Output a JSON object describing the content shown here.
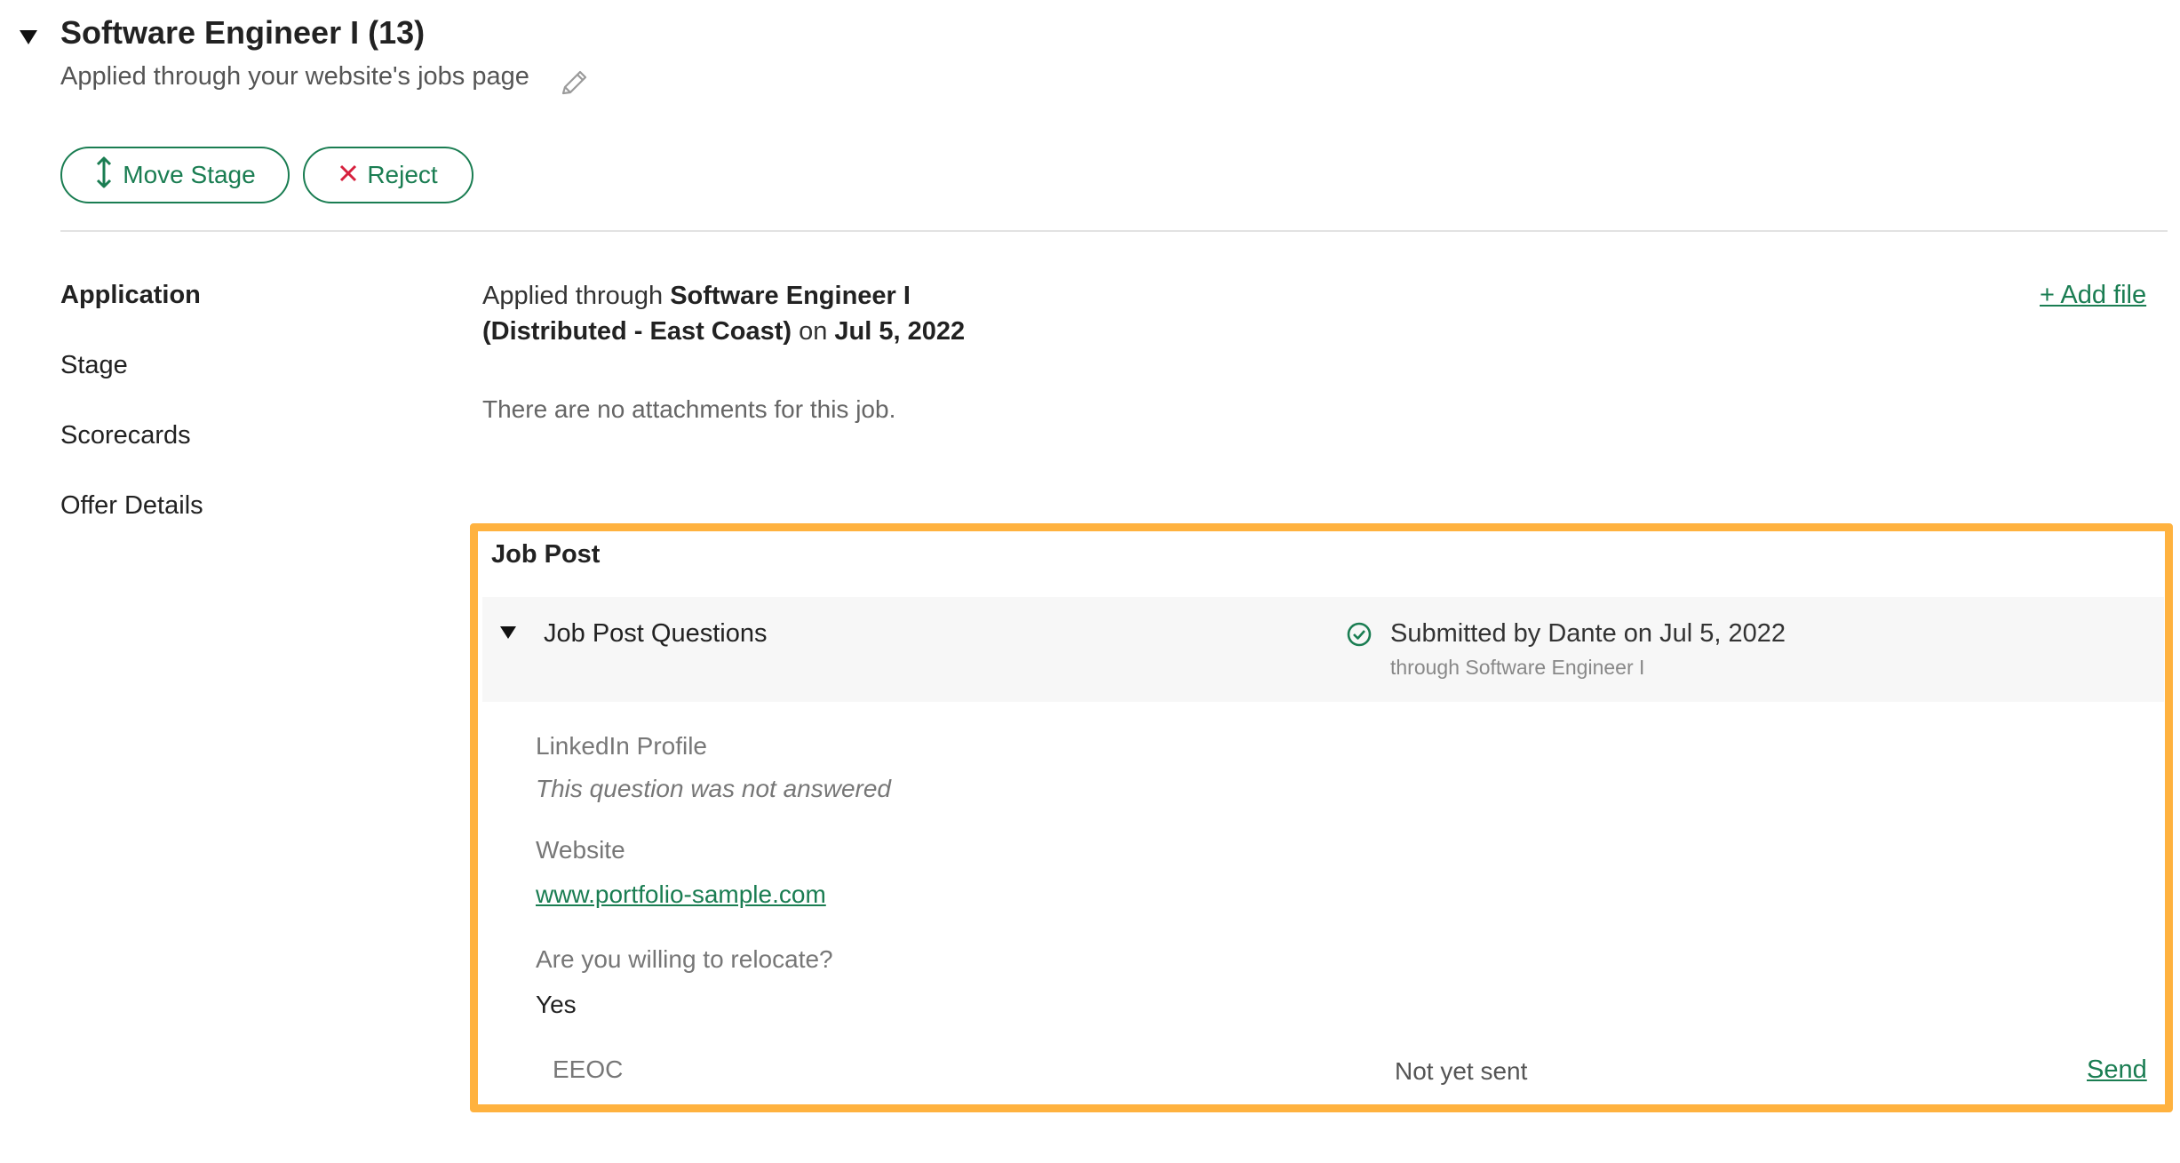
{
  "header": {
    "title": "Software Engineer I (13)",
    "subtitle": "Applied through your website's jobs page"
  },
  "actions": {
    "move_stage_label": "Move Stage",
    "reject_label": "Reject"
  },
  "nav": {
    "items": [
      {
        "label": "Application",
        "active": true
      },
      {
        "label": "Stage",
        "active": false
      },
      {
        "label": "Scorecards",
        "active": false
      },
      {
        "label": "Offer Details",
        "active": false
      }
    ]
  },
  "application": {
    "prefix": "Applied through ",
    "job_line1": "Software Engineer I",
    "job_line2": "(Distributed - East Coast)",
    "on": " on ",
    "date": "Jul 5, 2022",
    "no_attachments": "There are no attachments for this job.",
    "add_file_label": "+ Add file"
  },
  "job_post": {
    "title": "Job Post",
    "questions_label": "Job Post Questions",
    "submitted": "Submitted by Dante on Jul 5, 2022",
    "through": "through Software Engineer I",
    "questions": [
      {
        "label": "LinkedIn Profile",
        "answer": "This question was not answered"
      },
      {
        "label": "Website",
        "answer": "www.portfolio-sample.com"
      },
      {
        "label": "Are you willing to relocate?",
        "answer": "Yes"
      }
    ],
    "eeoc": {
      "label": "EEOC",
      "status": "Not yet sent",
      "send_label": "Send"
    }
  },
  "colors": {
    "accent": "#1a7d52",
    "highlight": "#ffb23f",
    "reject": "#d6203d"
  }
}
